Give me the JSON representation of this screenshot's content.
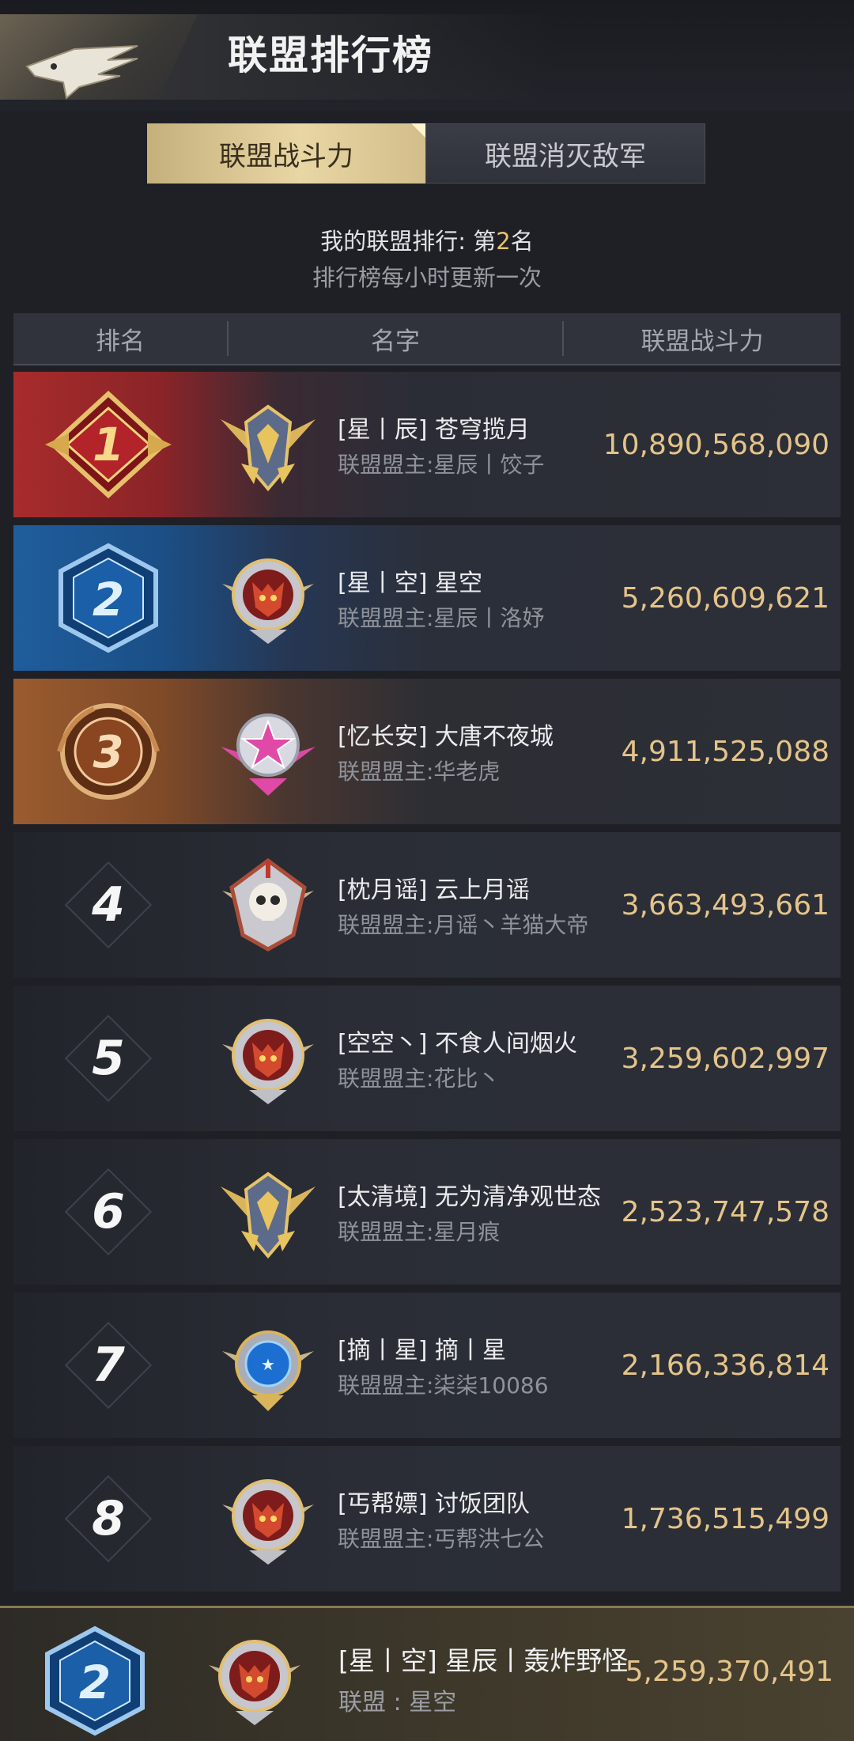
{
  "header": {
    "title": "联盟排行榜",
    "tabs": [
      {
        "label": "联盟战斗力",
        "active": true
      },
      {
        "label": "联盟消灭敌军",
        "active": false
      }
    ]
  },
  "my_rank": {
    "label": "我的联盟排行: 第",
    "rank": "2",
    "suffix": "名",
    "update_note": "排行榜每小时更新一次"
  },
  "columns": [
    "排名",
    "名字",
    "联盟战斗力"
  ],
  "rows": [
    {
      "rank": "1",
      "name": "[星丨辰] 苍穹揽月",
      "leader": "联盟盟主:星辰丨饺子",
      "power": "10,890,568,090",
      "emblem": "gold-wings"
    },
    {
      "rank": "2",
      "name": "[星丨空] 星空",
      "leader": "联盟盟主:星辰丨洛妤",
      "power": "5,260,609,621",
      "emblem": "wolf"
    },
    {
      "rank": "3",
      "name": "[忆长安] 大唐不夜城",
      "leader": "联盟盟主:华老虎",
      "power": "4,911,525,088",
      "emblem": "pink-star"
    },
    {
      "rank": "4",
      "name": "[枕月谣] 云上月谣",
      "leader": "联盟盟主:月谣丶羊猫大帝",
      "power": "3,663,493,661",
      "emblem": "skull"
    },
    {
      "rank": "5",
      "name": "[空空丶] 不食人间烟火",
      "leader": "联盟盟主:花比丶",
      "power": "3,259,602,997",
      "emblem": "wolf"
    },
    {
      "rank": "6",
      "name": "[太清境] 无为清净观世态",
      "leader": "联盟盟主:星月痕",
      "power": "2,523,747,578",
      "emblem": "gold-wings"
    },
    {
      "rank": "7",
      "name": "[摘丨星] 摘丨星",
      "leader": "联盟盟主:柒柒10086",
      "power": "2,166,336,814",
      "emblem": "blue-globe"
    },
    {
      "rank": "8",
      "name": "[丐帮嫖] 讨饭团队",
      "leader": "联盟盟主:丐帮洪七公",
      "power": "1,736,515,499",
      "emblem": "wolf"
    }
  ],
  "my_alliance": {
    "rank": "2",
    "name": "[星丨空] 星辰丨轰炸野怪",
    "alliance_label": "联盟 : 星空",
    "power": "5,259,370,491",
    "emblem": "wolf"
  },
  "colors": {
    "gold_text": "#e4c48a",
    "rank1": "#a82b2b",
    "rank2": "#1f5d9c",
    "rank3": "#9a5b2e",
    "tab_active": "#e8d6a4"
  }
}
